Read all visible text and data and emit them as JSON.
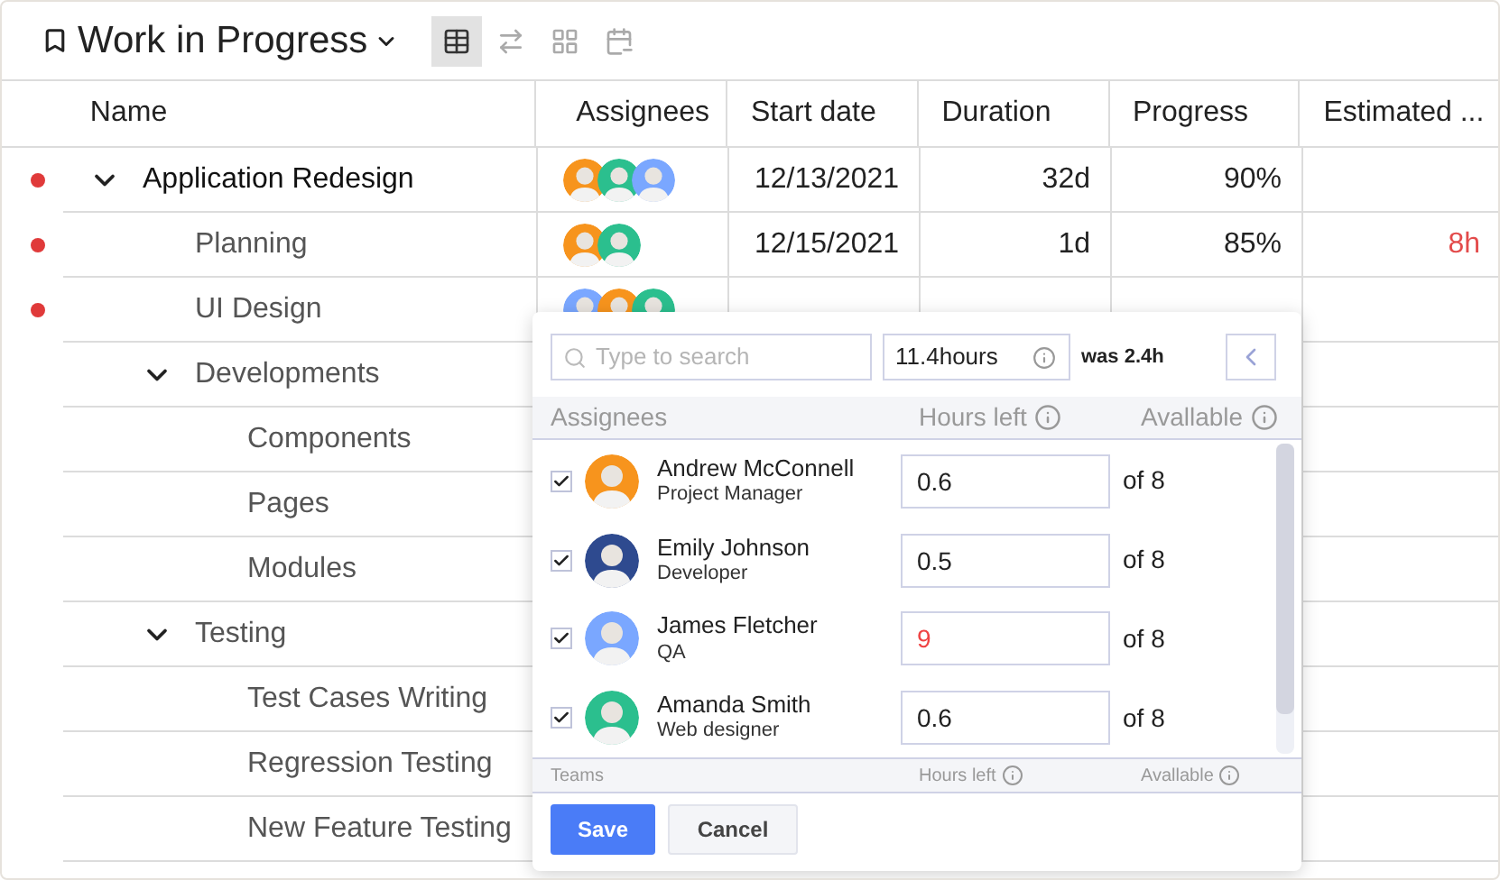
{
  "header": {
    "title": "Work in Progress",
    "views": [
      {
        "kind": "table",
        "selected": true
      },
      {
        "kind": "flow",
        "selected": false
      },
      {
        "kind": "grid",
        "selected": false
      },
      {
        "kind": "calendar",
        "selected": false
      }
    ]
  },
  "table": {
    "columns": [
      "Name",
      "Assignees",
      "Start date",
      "Duration",
      "Progress",
      "Estimated ..."
    ],
    "rows": [
      {
        "name": "Application Redesign",
        "flagged": true,
        "expanded": true,
        "assignees": [
          {
            "color": "#f7941d"
          },
          {
            "color": "#2bbf8e"
          },
          {
            "color": "#7aa7ff"
          }
        ],
        "start": "12/13/2021",
        "duration": "32d",
        "progress": "90%",
        "children": [
          {
            "name": "Planning",
            "flagged": true,
            "assignees": [
              {
                "color": "#f7941d"
              },
              {
                "color": "#2bbf8e"
              }
            ],
            "start": "12/15/2021",
            "duration": "1d",
            "progress": "85%",
            "estimate": "8h"
          },
          {
            "name": "UI Design",
            "flagged": true,
            "assignees": [
              {
                "color": "#7aa7ff"
              },
              {
                "color": "#f7941d"
              },
              {
                "color": "#2bbf8e"
              }
            ]
          },
          {
            "name": "Developments",
            "flagged": false,
            "expanded": true,
            "children": [
              {
                "name": "Components",
                "flagged": false
              },
              {
                "name": "Pages",
                "flagged": false
              },
              {
                "name": "Modules",
                "flagged": false
              }
            ]
          },
          {
            "name": "Testing",
            "flagged": false,
            "expanded": true,
            "children": [
              {
                "name": "Test Cases Writing",
                "flagged": false
              },
              {
                "name": "Regression Testing",
                "flagged": false
              },
              {
                "name": "New Feature Testing",
                "flagged": false
              }
            ]
          }
        ]
      }
    ]
  },
  "popup": {
    "search": {
      "placeholder": "Type to search"
    },
    "hours": {
      "value": "11.4hours"
    },
    "was": "was 2.4h",
    "columns": [
      "Assignees",
      "Hours left",
      "Avallable"
    ],
    "people": [
      {
        "name": "Andrew McConnell",
        "role": "Project Manager",
        "checked": true,
        "color": "#f7941d",
        "hours": "0.6",
        "over": false,
        "available": "of 8"
      },
      {
        "name": "Emily Johnson",
        "role": "Developer",
        "checked": true,
        "color": "#2e4a8f",
        "hours": "0.5",
        "over": false,
        "available": "of 8"
      },
      {
        "name": "James Fletcher",
        "role": "QA",
        "checked": true,
        "color": "#7aa7ff",
        "hours": "9",
        "over": true,
        "available": "of 8"
      },
      {
        "name": "Amanda Smith",
        "role": "Web designer",
        "checked": true,
        "color": "#2bbf8e",
        "hours": "0.6",
        "over": false,
        "available": "of 8"
      }
    ],
    "footer": [
      "Teams",
      "Hours left",
      "Avallable"
    ],
    "buttons": [
      "Save",
      "Cancel"
    ]
  }
}
